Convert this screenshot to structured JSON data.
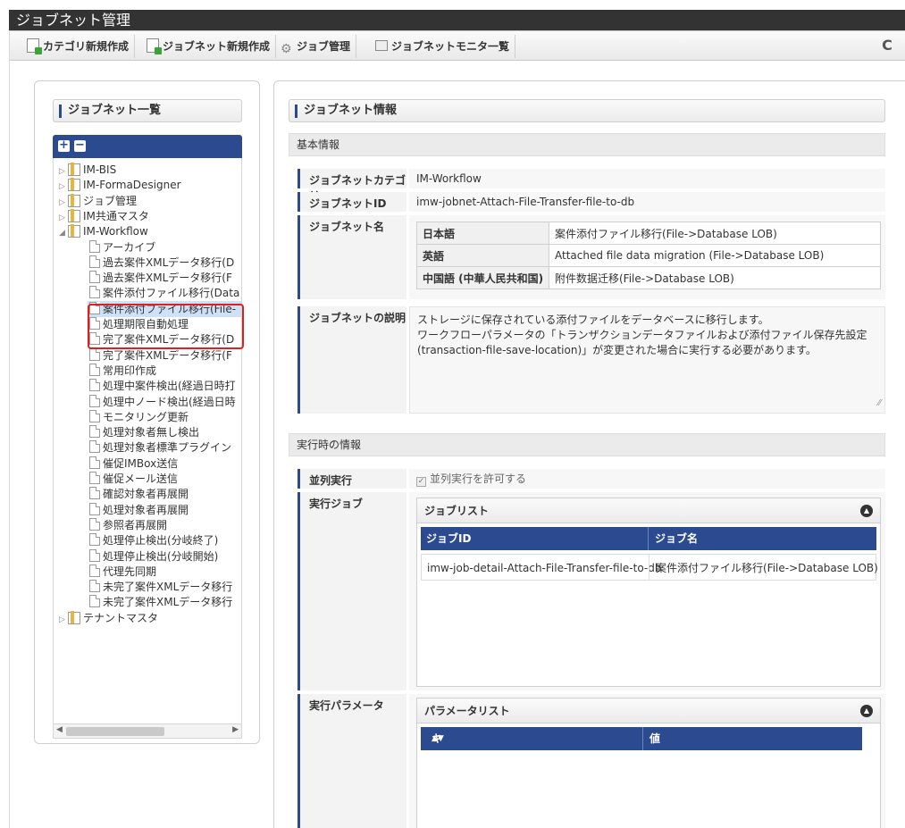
{
  "app": {
    "title": "ジョブネット管理"
  },
  "toolbar": {
    "new_category": "カテゴリ新規作成",
    "new_jobnet": "ジョブネット新規作成",
    "job_manage": "ジョブ管理",
    "jobnet_monitor": "ジョブネットモニタ一覧",
    "refresh_icon": "refresh-icon"
  },
  "left": {
    "heading": "ジョブネット一覧",
    "tree": [
      {
        "label": "IM-BIS",
        "type": "folder",
        "arrow": "▷"
      },
      {
        "label": "IM-FormaDesigner",
        "type": "folder",
        "arrow": "▷"
      },
      {
        "label": "ジョブ管理",
        "type": "folder",
        "arrow": "▷"
      },
      {
        "label": "IM共通マスタ",
        "type": "folder",
        "arrow": "▷"
      },
      {
        "label": "IM-Workflow",
        "type": "folder",
        "arrow": "◢"
      },
      {
        "label": "アーカイブ",
        "type": "page"
      },
      {
        "label": "過去案件XMLデータ移行(D",
        "type": "page"
      },
      {
        "label": "過去案件XMLデータ移行(F",
        "type": "page"
      },
      {
        "label": "案件添付ファイル移行(Data",
        "type": "page"
      },
      {
        "label": "案件添付ファイル移行(File-",
        "type": "page",
        "selected": true
      },
      {
        "label": "処理期限自動処理",
        "type": "page"
      },
      {
        "label": "完了案件XMLデータ移行(D",
        "type": "page"
      },
      {
        "label": "完了案件XMLデータ移行(F",
        "type": "page"
      },
      {
        "label": "常用印作成",
        "type": "page"
      },
      {
        "label": "処理中案件検出(経過日時打",
        "type": "page"
      },
      {
        "label": "処理中ノード検出(経過日時",
        "type": "page"
      },
      {
        "label": "モニタリング更新",
        "type": "page"
      },
      {
        "label": "処理対象者無し検出",
        "type": "page"
      },
      {
        "label": "処理対象者標準プラグイン",
        "type": "page"
      },
      {
        "label": "催促IMBox送信",
        "type": "page"
      },
      {
        "label": "催促メール送信",
        "type": "page"
      },
      {
        "label": "確認対象者再展開",
        "type": "page"
      },
      {
        "label": "処理対象者再展開",
        "type": "page"
      },
      {
        "label": "参照者再展開",
        "type": "page"
      },
      {
        "label": "処理停止検出(分岐終了)",
        "type": "page"
      },
      {
        "label": "処理停止検出(分岐開始)",
        "type": "page"
      },
      {
        "label": "代理先同期",
        "type": "page"
      },
      {
        "label": "未完了案件XMLデータ移行",
        "type": "page"
      },
      {
        "label": "未完了案件XMLデータ移行",
        "type": "page"
      },
      {
        "label": "テナントマスタ",
        "type": "folder",
        "arrow": "▷"
      }
    ]
  },
  "right": {
    "heading": "ジョブネット情報",
    "basic_info": "基本情報",
    "fields": {
      "category_label": "ジョブネットカテゴリ",
      "category_value": "IM-Workflow",
      "id_label": "ジョブネットID",
      "id_value": "imw-jobnet-Attach-File-Transfer-file-to-db",
      "name_label": "ジョブネット名",
      "names": [
        {
          "lang": "日本語",
          "value": "案件添付ファイル移行(File->Database LOB)"
        },
        {
          "lang": "英語",
          "value": "Attached file data migration (File->Database LOB)"
        },
        {
          "lang": "中国語 (中華人民共和国)",
          "value": "附件数据迁移(File->Database LOB)"
        }
      ],
      "desc_label": "ジョブネットの説明",
      "desc_lines": [
        "ストレージに保存されている添付ファイルをデータベースに移行します。",
        "ワークフローパラメータの「トランザクションデータファイルおよび添付ファイル保存先設定",
        "(transaction-file-save-location)」が変更された場合に実行する必要があります。"
      ]
    },
    "runtime_info": "実行時の情報",
    "parallel_label": "並列実行",
    "parallel_value": "並列実行を許可する",
    "job_label": "実行ジョブ",
    "job_list": {
      "title": "ジョブリスト",
      "col_id": "ジョブID",
      "col_name": "ジョブ名",
      "rows": [
        {
          "id": "imw-job-detail-Attach-File-Transfer-file-to-db",
          "name": "案件添付ファイル移行(File->Database LOB)"
        }
      ]
    },
    "param_label": "実行パラメータ",
    "param_list": {
      "title": "パラメータリスト",
      "col_key": "キー",
      "col_value": "値"
    }
  }
}
